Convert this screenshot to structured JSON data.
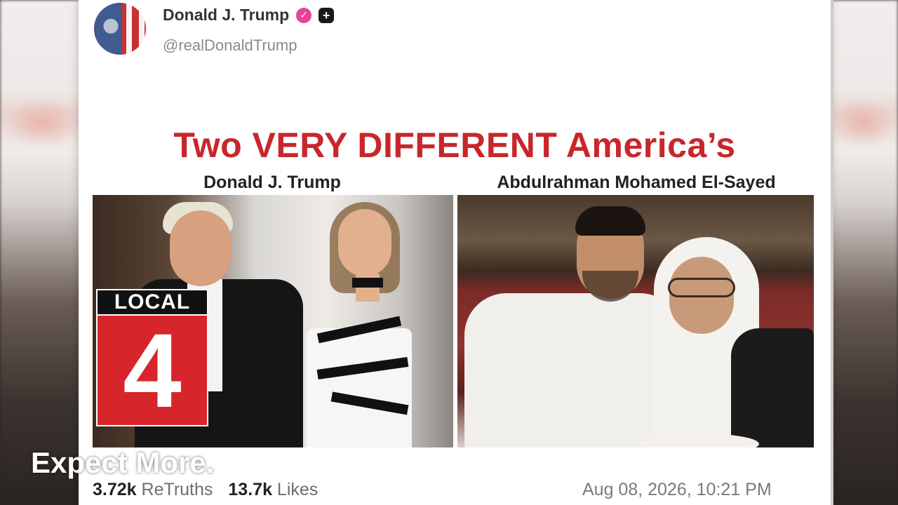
{
  "post": {
    "author_name": "Donald J. Trump",
    "handle": "@realDonaldTrump",
    "verified_icon": "check-badge-icon",
    "follow_icon": "plus-icon",
    "headline": "Two VERY DIFFERENT America’s",
    "left_caption": "Donald J. Trump",
    "right_caption": "Abdulrahman Mohamed El-Sayed",
    "retruths_count": "3.72k",
    "retruths_label": "ReTruths",
    "likes_count": "13.7k",
    "likes_label": "Likes",
    "timestamp": "Aug 08, 2026, 10:21 PM"
  },
  "overlay": {
    "station_top": "LOCAL",
    "station_number": "4",
    "tagline": "Expect More."
  },
  "colors": {
    "headline": "#c8262b",
    "verified": "#e6429a",
    "station_red": "#d7262b"
  }
}
